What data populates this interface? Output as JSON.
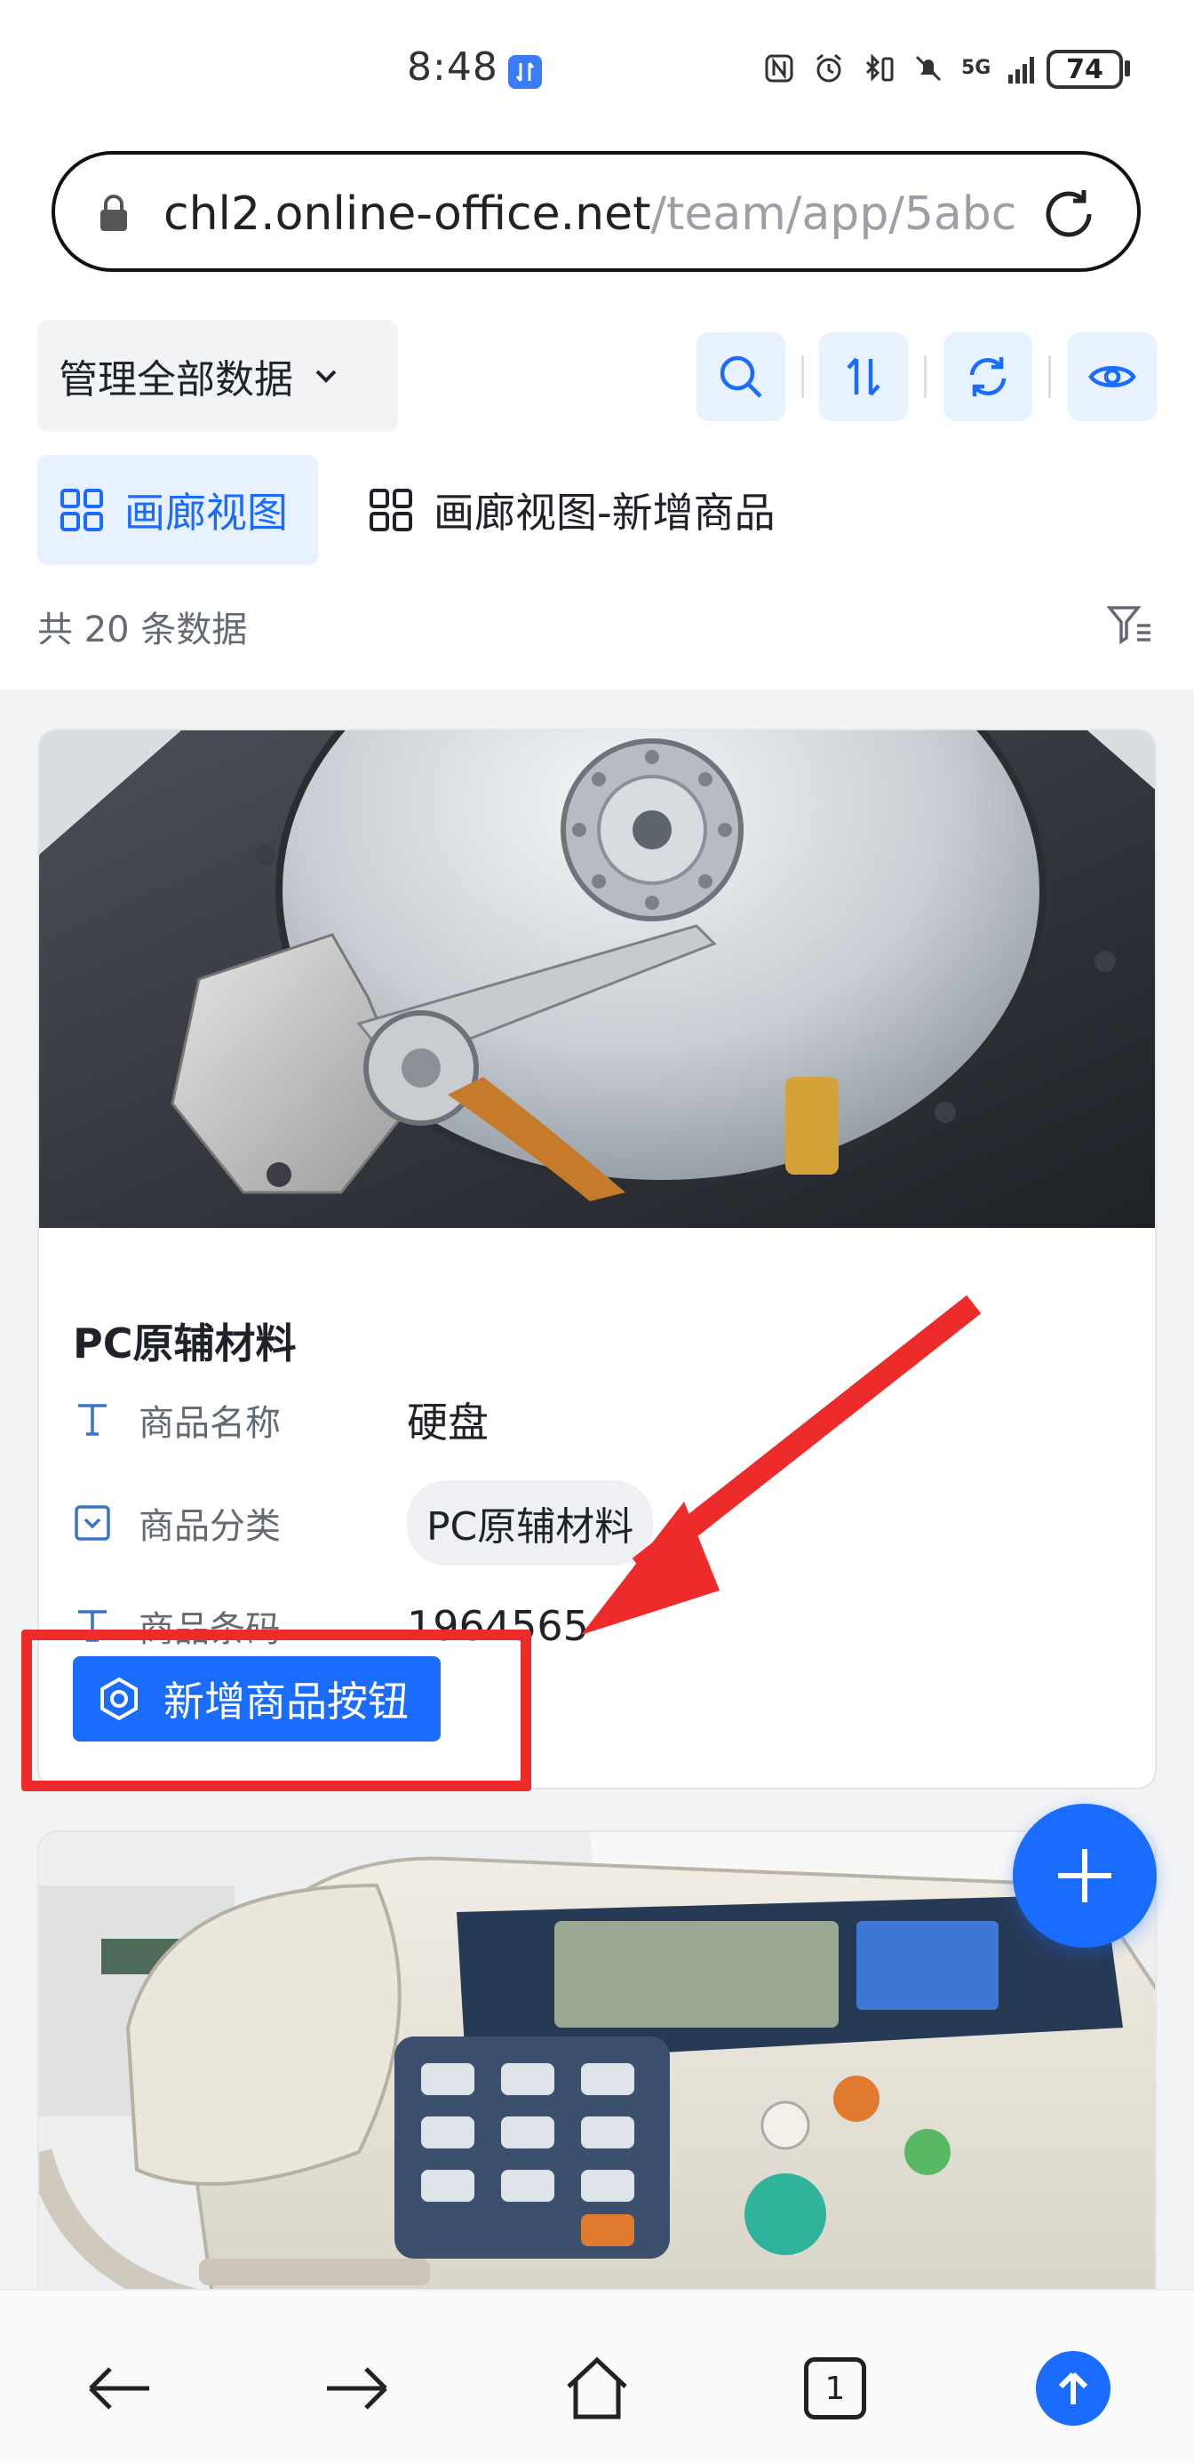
{
  "status_bar": {
    "time": "8:48",
    "battery": "74",
    "network": "5G"
  },
  "browser": {
    "url_host": "chl2.online-office.net",
    "url_path": "/team/app/5abc"
  },
  "toolbar": {
    "scope_label": "管理全部数据",
    "icons": [
      "search-icon",
      "sort-icon",
      "refresh-icon",
      "eye-icon"
    ]
  },
  "view_tabs": [
    {
      "label": "画廊视图",
      "active": true
    },
    {
      "label": "画廊视图-新增商品",
      "active": false
    }
  ],
  "record_count_text": "共 20 条数据",
  "cards": [
    {
      "title": "PC原辅材料",
      "image": "hard-disk-drive-photo",
      "fields": [
        {
          "label": "商品名称",
          "value": "硬盘",
          "icon": "text-field-icon"
        },
        {
          "label": "商品分类",
          "value": "PC原辅材料",
          "icon": "select-field-icon"
        },
        {
          "label": "商品条码",
          "value": "1964565",
          "icon": "text-field-icon"
        }
      ],
      "action_label": "新增商品按钮"
    },
    {
      "title": "",
      "image": "fax-machine-photo"
    }
  ],
  "annotation_color": "#ee2b2b",
  "accent_color": "#1a6cff",
  "bottom_nav": {
    "tab_count": "1",
    "icons": [
      "back-arrow-icon",
      "forward-arrow-icon",
      "home-icon",
      "tabs-icon",
      "scroll-top-icon"
    ]
  }
}
